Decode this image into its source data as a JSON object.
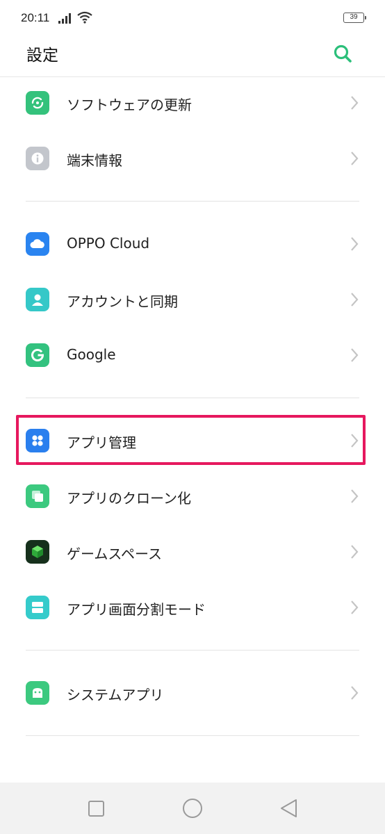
{
  "status_bar": {
    "time": "20:11",
    "battery": "39"
  },
  "header": {
    "title": "設定"
  },
  "colors": {
    "accent": "#2bbf7a",
    "highlight": "#e6185e"
  },
  "sections": [
    {
      "items": [
        {
          "label": "ソフトウェアの更新",
          "icon": "software-update-icon",
          "color": "#34c27c"
        },
        {
          "label": "端末情報",
          "icon": "info-icon",
          "color": "#c3c6cc"
        }
      ]
    },
    {
      "items": [
        {
          "label": "OPPO Cloud",
          "icon": "cloud-icon",
          "color": "#2a84f0"
        },
        {
          "label": "アカウントと同期",
          "icon": "account-icon",
          "color": "#35c8c8"
        },
        {
          "label": "Google",
          "icon": "google-icon",
          "color": "#33c27f"
        }
      ]
    },
    {
      "items": [
        {
          "label": "アプリ管理",
          "icon": "app-management-icon",
          "color": "#2a7fee",
          "highlighted": true
        },
        {
          "label": "アプリのクローン化",
          "icon": "app-clone-icon",
          "color": "#3cc97f"
        },
        {
          "label": "ゲームスペース",
          "icon": "game-space-icon",
          "color": "#1f8a3a"
        },
        {
          "label": "アプリ画面分割モード",
          "icon": "split-screen-icon",
          "color": "#35cbcb"
        }
      ]
    },
    {
      "items": [
        {
          "label": "システムアプリ",
          "icon": "system-apps-icon",
          "color": "#3cc97f"
        }
      ]
    }
  ],
  "nav_bar": {
    "recent": "recent-apps-icon",
    "home": "home-icon",
    "back": "back-icon"
  }
}
